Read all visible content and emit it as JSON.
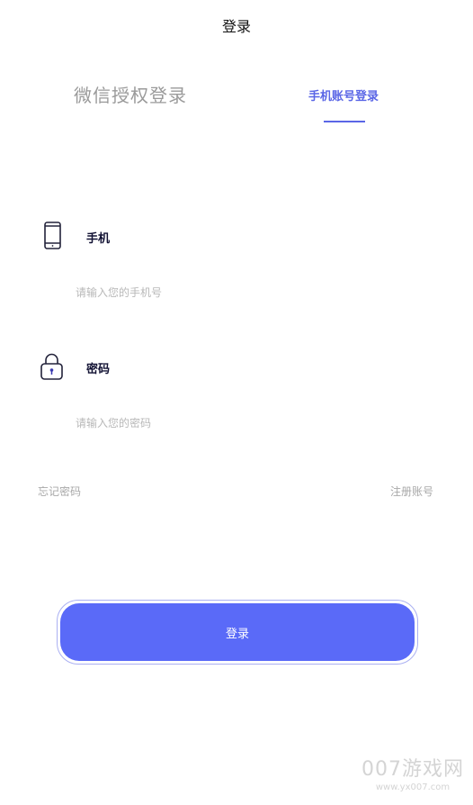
{
  "header": {
    "title": "登录"
  },
  "tabs": {
    "wechat_label": "微信授权登录",
    "phone_label": "手机账号登录"
  },
  "form": {
    "phone_label": "手机",
    "phone_placeholder": "请输入您的手机号",
    "password_label": "密码",
    "password_placeholder": "请输入您的密码",
    "forgot_label": "忘记密码",
    "register_label": "注册账号",
    "submit_label": "登录"
  },
  "watermark": {
    "brand": "007游戏网",
    "url": "www.yx007.com"
  },
  "colors": {
    "accent": "#5a66e6",
    "button": "#5a6af8",
    "placeholder": "#b8b8b8"
  },
  "icons": {
    "phone": "smartphone-icon",
    "password": "padlock-icon"
  }
}
